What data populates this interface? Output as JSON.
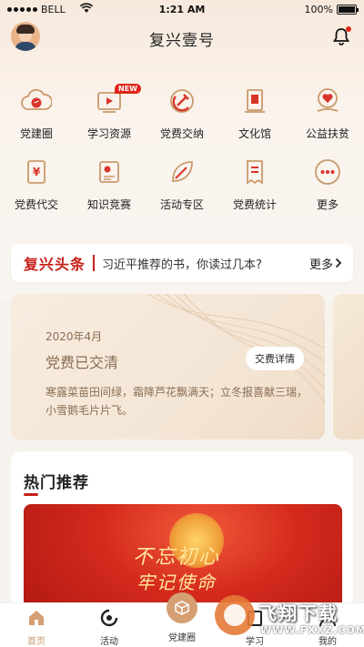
{
  "status_bar": {
    "carrier": "BELL",
    "time": "1:21 AM",
    "battery": "100%"
  },
  "header": {
    "title": "复兴壹号"
  },
  "grid": [
    {
      "label": "党建圈",
      "icon": "cloud-party-icon"
    },
    {
      "label": "学习资源",
      "icon": "video-play-icon",
      "badge": "NEW"
    },
    {
      "label": "党费交纳",
      "icon": "hammer-sickle-icon"
    },
    {
      "label": "文化馆",
      "icon": "document-stack-icon"
    },
    {
      "label": "公益扶贫",
      "icon": "heart-hand-icon"
    },
    {
      "label": "党费代交",
      "icon": "yuan-bill-icon"
    },
    {
      "label": "知识竞赛",
      "icon": "certificate-icon"
    },
    {
      "label": "活动专区",
      "icon": "leaf-icon"
    },
    {
      "label": "党费统计",
      "icon": "receipt-icon"
    },
    {
      "label": "更多",
      "icon": "more-dots-icon"
    }
  ],
  "headline": {
    "brand": "复兴头条",
    "text": "习近平推荐的书，你读过几本?",
    "more": "更多"
  },
  "pay_card": {
    "date": "2020年4月",
    "state": "党费已交清",
    "button": "交费详情",
    "poem": "寒露菜苗田间绿，霜降芦花飘满天；立冬报喜献三瑞，小雪鹅毛片片飞。"
  },
  "hot": {
    "title": "热门推荐",
    "banner_line1": "不忘初心",
    "banner_line2": "牢记使命"
  },
  "tabbar": [
    {
      "label": "首页",
      "active": true
    },
    {
      "label": "活动",
      "active": false
    },
    {
      "label": "党建圈",
      "active": false
    },
    {
      "label": "学习",
      "active": false
    },
    {
      "label": "我的",
      "active": false
    }
  ],
  "watermark": {
    "line1": "飞翔下载",
    "line2": "WWW.FXXZ.COM"
  },
  "colors": {
    "accent": "#c8201a",
    "icon_gold": "#c99a6c",
    "icon_red": "#d8352a"
  }
}
